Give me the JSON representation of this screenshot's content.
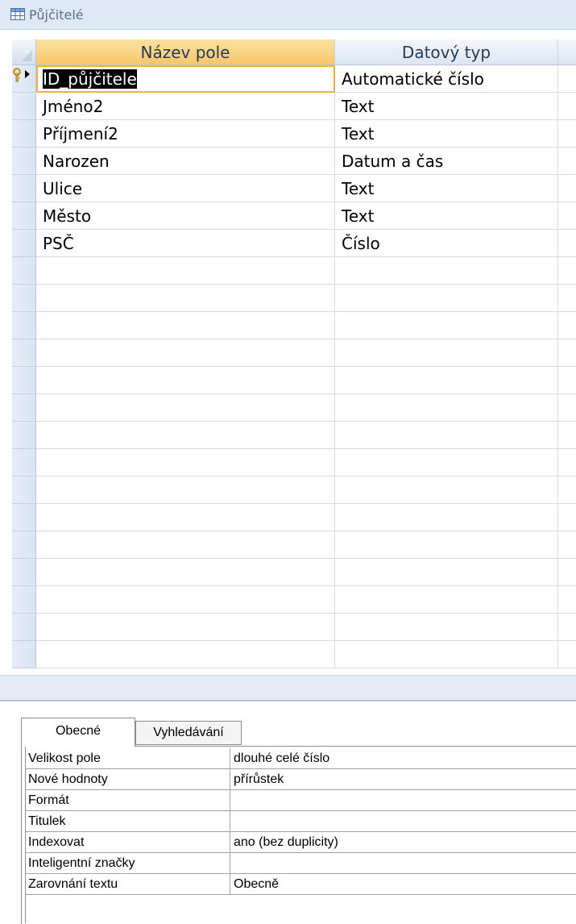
{
  "window": {
    "title": "Půjčitelé",
    "icon": "table-icon"
  },
  "grid": {
    "headers": {
      "name": "Název pole",
      "type": "Datový typ"
    },
    "rows": [
      {
        "name": "ID_půjčitele",
        "type": "Automatické číslo",
        "primary_key": true,
        "selected": true
      },
      {
        "name": "Jméno2",
        "type": "Text"
      },
      {
        "name": "Příjmení2",
        "type": "Text"
      },
      {
        "name": "Narozen",
        "type": "Datum a čas"
      },
      {
        "name": "Ulice",
        "type": "Text"
      },
      {
        "name": "Město",
        "type": "Text"
      },
      {
        "name": "PSČ",
        "type": "Číslo"
      }
    ],
    "empty_rows": 15
  },
  "properties": {
    "tabs": {
      "general": "Obecné",
      "lookup": "Vyhledávání"
    },
    "active_tab": "general",
    "rows": [
      {
        "label": "Velikost pole",
        "value": "dlouhé celé číslo"
      },
      {
        "label": "Nové hodnoty",
        "value": "přírůstek"
      },
      {
        "label": "Formát",
        "value": ""
      },
      {
        "label": "Titulek",
        "value": ""
      },
      {
        "label": "Indexovat",
        "value": "ano (bez duplicity)"
      },
      {
        "label": "Inteligentní značky",
        "value": ""
      },
      {
        "label": "Zarovnání textu",
        "value": "Obecně"
      }
    ]
  },
  "colors": {
    "active_header": "#f7c76a",
    "selection_border": "#f0b050",
    "titlebar_bg": "#dfe8f5"
  }
}
